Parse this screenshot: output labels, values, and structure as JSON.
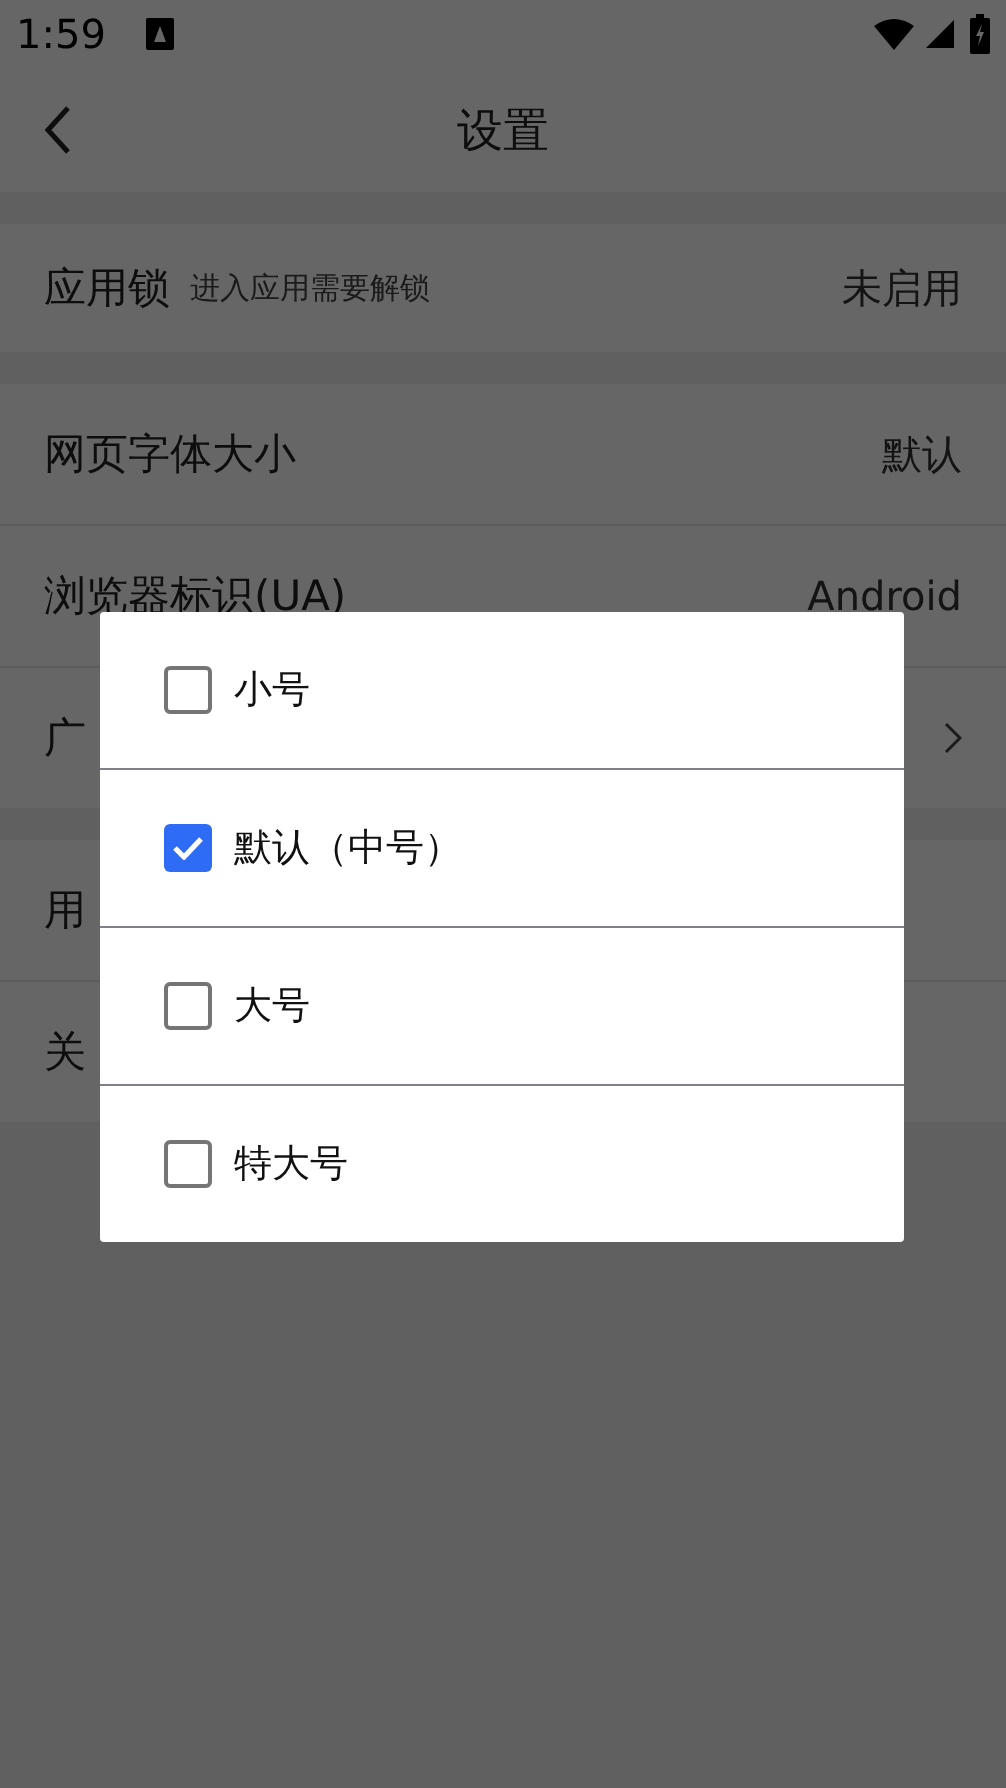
{
  "status_bar": {
    "time": "1:59"
  },
  "header": {
    "title": "设置"
  },
  "sections": [
    {
      "rows": [
        {
          "label": "应用锁",
          "hint": "进入应用需要解锁",
          "value": "未启用",
          "chevron": false
        }
      ]
    },
    {
      "rows": [
        {
          "label": "网页字体大小",
          "value": "默认",
          "chevron": false
        },
        {
          "label": "浏览器标识(UA)",
          "value": "Android",
          "chevron": false
        },
        {
          "label": "广",
          "chevron": true
        }
      ]
    },
    {
      "rows": [
        {
          "label": "用",
          "chevron": false
        },
        {
          "label": "关",
          "chevron": false
        }
      ]
    }
  ],
  "dialog": {
    "options": [
      {
        "label": "小号",
        "selected": false
      },
      {
        "label": "默认（中号）",
        "selected": true
      },
      {
        "label": "大号",
        "selected": false
      },
      {
        "label": "特大号",
        "selected": false
      }
    ]
  }
}
